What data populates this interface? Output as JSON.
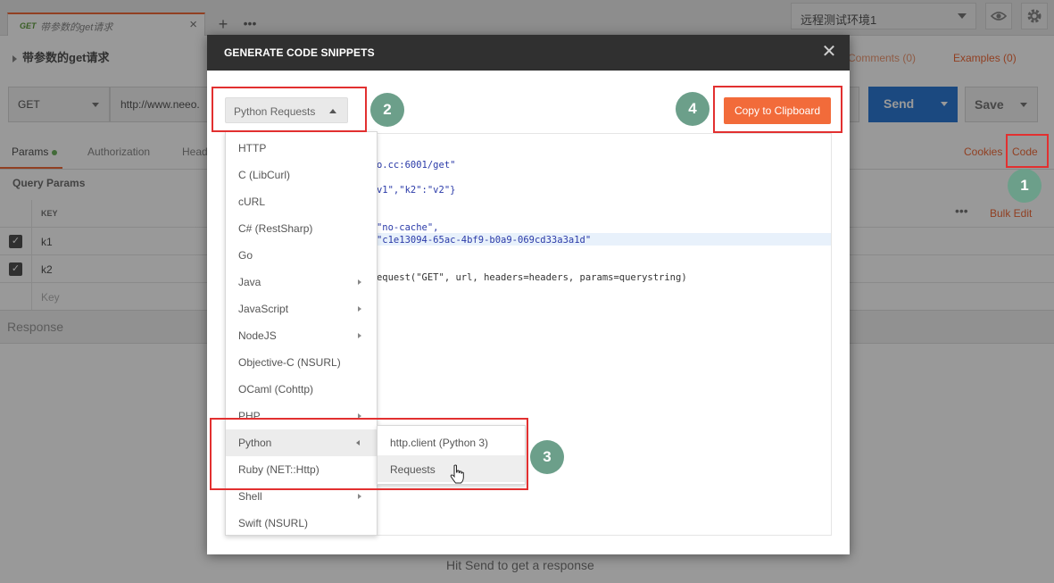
{
  "tab": {
    "method": "GET",
    "name": "带参数的get请求"
  },
  "environment": {
    "selected": "远程测试环境1"
  },
  "request": {
    "title": "带参数的get请求",
    "method": "GET",
    "url_prefix": "http://www.neeo.",
    "send_label": "Send",
    "save_label": "Save",
    "comments_label": "Comments (0)",
    "examples_label": "Examples (0)"
  },
  "subtabs": {
    "params": "Params",
    "authorization": "Authorization",
    "headers": "Head",
    "cookies": "Cookies",
    "code": "Code"
  },
  "params": {
    "heading": "Query Params",
    "key_header": "KEY",
    "bulk_edit": "Bulk Edit",
    "rows": [
      {
        "key": "k1"
      },
      {
        "key": "k2"
      }
    ],
    "placeholder": "Key"
  },
  "response": {
    "label": "Response",
    "hint": "Hit Send to get a response"
  },
  "modal": {
    "title": "GENERATE CODE SNIPPETS",
    "language_selected": "Python Requests",
    "copy_button": "Copy to Clipboard",
    "code_lines": {
      "l1": "neeo.cc:6001/get\"",
      "l2": "\":\"v1\",\"k2\":\"v2\"}",
      "l3": "': \"no-cache\",",
      "l4": "': \"c1e13094-65ac-4bf9-b0a9-069cd33a3a1d\"",
      "l5": "s.request(\"GET\", url, headers=headers, params=querystring)",
      "l6": "t)"
    }
  },
  "languages": [
    {
      "label": "HTTP",
      "has_sub": false
    },
    {
      "label": "C (LibCurl)",
      "has_sub": false
    },
    {
      "label": "cURL",
      "has_sub": false
    },
    {
      "label": "C# (RestSharp)",
      "has_sub": false
    },
    {
      "label": "Go",
      "has_sub": false
    },
    {
      "label": "Java",
      "has_sub": true
    },
    {
      "label": "JavaScript",
      "has_sub": true
    },
    {
      "label": "NodeJS",
      "has_sub": true
    },
    {
      "label": "Objective-C (NSURL)",
      "has_sub": false
    },
    {
      "label": "OCaml (Cohttp)",
      "has_sub": false
    },
    {
      "label": "PHP",
      "has_sub": true
    },
    {
      "label": "Python",
      "has_sub": true
    },
    {
      "label": "Ruby (NET::Http)",
      "has_sub": false
    },
    {
      "label": "Shell",
      "has_sub": true
    },
    {
      "label": "Swift (NSURL)",
      "has_sub": false
    }
  ],
  "python_submenu": [
    "http.client (Python 3)",
    "Requests"
  ],
  "annotations": {
    "n1": "1",
    "n2": "2",
    "n3": "3",
    "n4": "4"
  },
  "colors": {
    "accent": "#f26b3a",
    "send": "#2e7bd6",
    "annotation_red": "#e23030",
    "annotation_circle": "#6c9f8a"
  }
}
